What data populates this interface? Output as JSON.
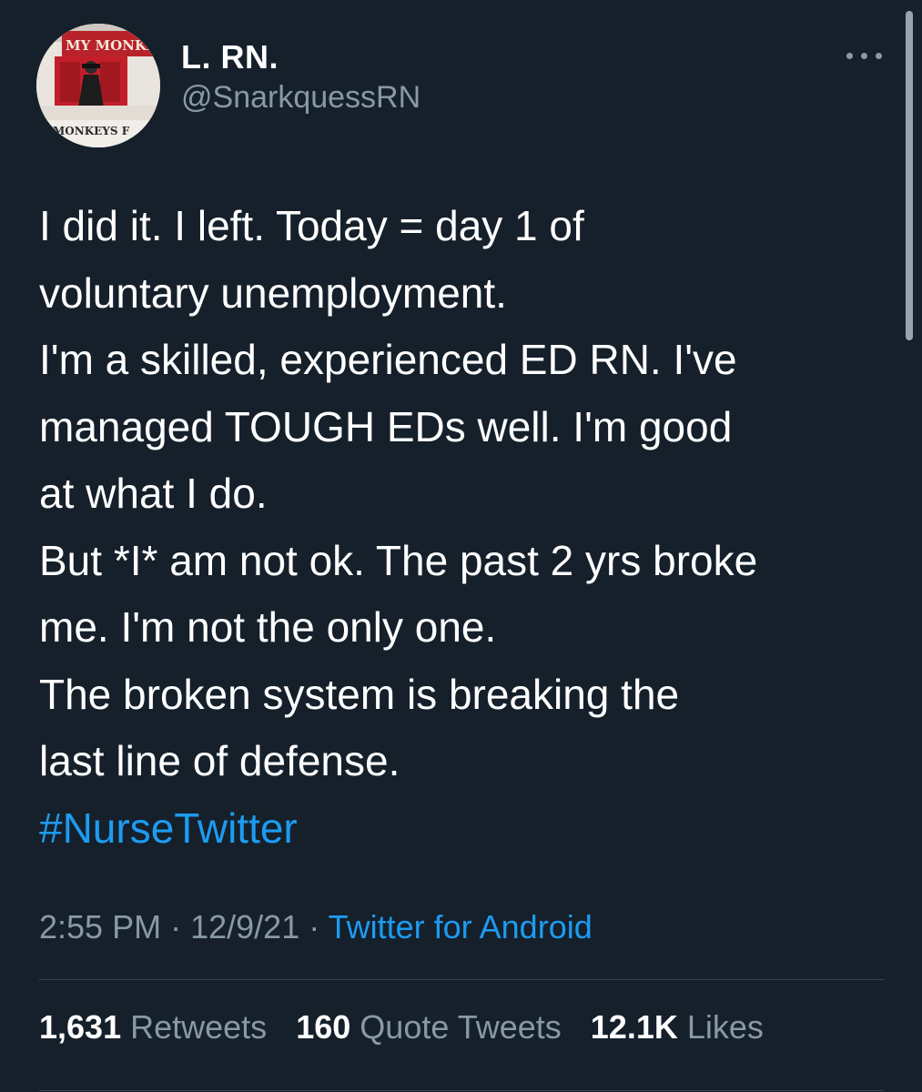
{
  "user": {
    "display_name": "L. RN.",
    "handle": "@SnarkquessRN",
    "avatar_banner_top": "MY MONKEYS",
    "avatar_banner_bottom": "MONKEYS F"
  },
  "tweet": {
    "body": "I did it. I left. Today = day 1 of\nvoluntary unemployment.\nI'm a skilled, experienced ED RN. I've\nmanaged TOUGH EDs well. I'm good\nat what I do.\nBut *I* am not ok. The past 2 yrs broke\nme. I'm not the only one.\nThe broken system is breaking the\nlast line of defense.",
    "hashtag": "#NurseTwitter",
    "time": "2:55 PM",
    "separator": "·",
    "date": "12/9/21",
    "source": "Twitter for Android"
  },
  "stats": [
    {
      "count": "1,631",
      "label": "Retweets"
    },
    {
      "count": "160",
      "label": "Quote Tweets"
    },
    {
      "count": "12.1K",
      "label": "Likes"
    }
  ],
  "icons": {
    "more": "more-options-icon"
  },
  "colors": {
    "background": "#15202b",
    "accent": "#1d9bf0",
    "secondary_text": "#8899a6"
  }
}
